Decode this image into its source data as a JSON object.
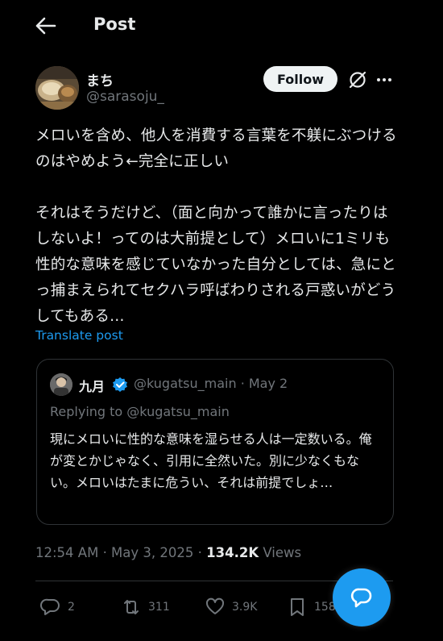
{
  "header": {
    "title": "Post"
  },
  "author": {
    "name": "まち",
    "handle": "@sarasoju_"
  },
  "follow_label": "Follow",
  "tweet": {
    "text": "メロいを含め、他人を消費する言葉を不躾にぶつけるのはやめよう←完全に正しい\n\nそれはそうだけど、（面と向かって誰かに言ったりはしないよ！ってのは大前提として）メロいに1ミリも性的な意味を感じていなかった自分としては、急にとっ捕まえられてセクハラ呼ばわりされる戸惑いがどうしてもある…"
  },
  "translate_label": "Translate post",
  "quote": {
    "name": "九月",
    "meta": "@kugatsu_main · May 2",
    "replying": "Replying to @kugatsu_main",
    "text": "現にメロいに性的な意味を湿らせる人は一定数いる。俺が変とかじゃなく、引用に全然いた。別に少なくもない。メロいはたまに危うい、それは前提でしょ…"
  },
  "meta": {
    "datetime": "12:54 AM · May 3, 2025 · ",
    "views_count": "134.2K",
    "views_label": " Views"
  },
  "actions": {
    "replies": "2",
    "reposts": "311",
    "likes": "3.9K",
    "bookmarks": "158"
  },
  "colors": {
    "background": "#000000",
    "text_primary": "#e7e9ea",
    "text_secondary": "#71767b",
    "accent": "#1d9bf0",
    "border": "#2f3336"
  },
  "icons": [
    "back-arrow-icon",
    "grok-icon",
    "more-icon",
    "verified-badge-icon",
    "reply-icon",
    "repost-icon",
    "like-icon",
    "bookmark-icon",
    "compose-icon"
  ]
}
